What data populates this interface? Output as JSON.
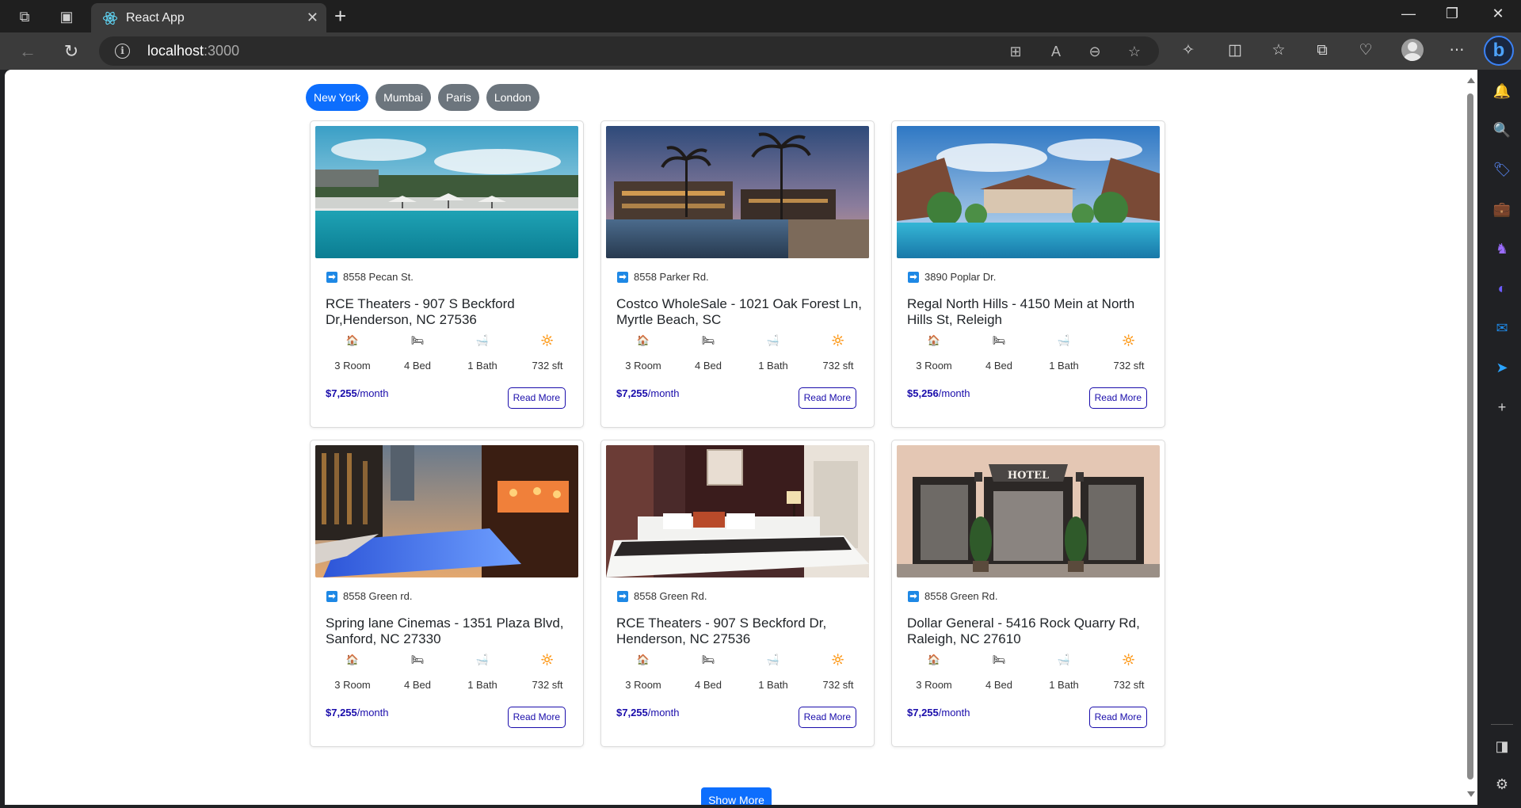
{
  "browser": {
    "tab_title": "React App",
    "url_host": "localhost",
    "url_port": ":3000"
  },
  "filters": [
    {
      "label": "New York",
      "active": true
    },
    {
      "label": "Mumbai",
      "active": false
    },
    {
      "label": "Paris",
      "active": false
    },
    {
      "label": "London",
      "active": false
    }
  ],
  "cards": [
    {
      "address": "8558 Pecan St.",
      "title": "RCE Theaters - 907 S Beckford Dr,Henderson, NC 27536",
      "rooms": "3 Room",
      "beds": "4 Bed",
      "baths": "1 Bath",
      "area": "732 sft",
      "price": "$7,255",
      "per": "/month",
      "read_more": "Read More"
    },
    {
      "address": "8558 Parker Rd.",
      "title": "Costco WholeSale - 1021 Oak Forest Ln, Myrtle Beach, SC",
      "rooms": "3 Room",
      "beds": "4 Bed",
      "baths": "1 Bath",
      "area": "732 sft",
      "price": "$7,255",
      "per": "/month",
      "read_more": "Read More"
    },
    {
      "address": "3890 Poplar Dr.",
      "title": "Regal North Hills - 4150 Mein at North Hills St, Releigh",
      "rooms": "3 Room",
      "beds": "4 Bed",
      "baths": "1 Bath",
      "area": "732 sft",
      "price": "$5,256",
      "per": "/month",
      "read_more": "Read More"
    },
    {
      "address": "8558 Green rd.",
      "title": "Spring lane Cinemas - 1351 Plaza Blvd, Sanford, NC 27330",
      "rooms": "3 Room",
      "beds": "4 Bed",
      "baths": "1 Bath",
      "area": "732 sft",
      "price": "$7,255",
      "per": "/month",
      "read_more": "Read More"
    },
    {
      "address": "8558 Green Rd.",
      "title": "RCE Theaters - 907 S Beckford Dr, Henderson, NC 27536",
      "rooms": "3 Room",
      "beds": "4 Bed",
      "baths": "1 Bath",
      "area": "732 sft",
      "price": "$7,255",
      "per": "/month",
      "read_more": "Read More"
    },
    {
      "address": "8558 Green Rd.",
      "title": "Dollar General - 5416 Rock Quarry Rd, Raleigh, NC 27610",
      "rooms": "3 Room",
      "beds": "4 Bed",
      "baths": "1 Bath",
      "area": "732 sft",
      "price": "$7,255",
      "per": "/month",
      "read_more": "Read More"
    }
  ],
  "hotel_sign": "HOTEL",
  "show_more": "Show More",
  "icons": {
    "feature_room": "house-icon",
    "feature_bed": "bed-icon",
    "feature_bath": "bathtub-icon",
    "feature_area": "area-icon",
    "address": "arrow-right-icon"
  },
  "colors": {
    "primary": "#0d6efd",
    "secondary": "#6c757d",
    "price": "#1a0dab"
  }
}
